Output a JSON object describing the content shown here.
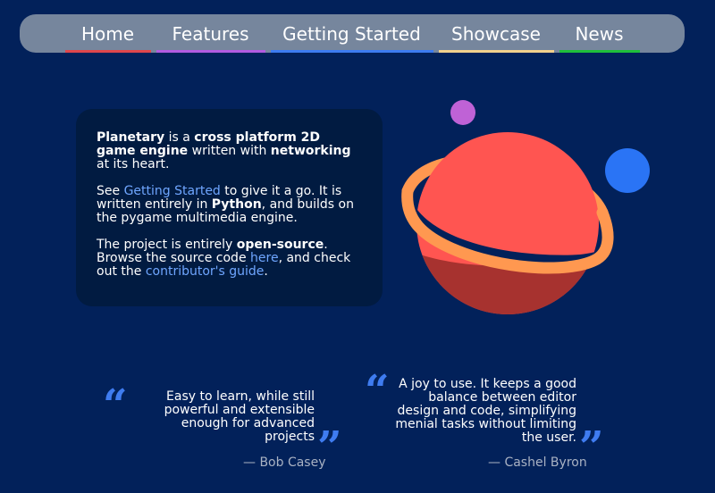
{
  "nav": {
    "items": [
      {
        "label": "Home",
        "color": "#e0474c"
      },
      {
        "label": "Features",
        "color": "#b25ce0"
      },
      {
        "label": "Getting Started",
        "color": "#3d7cf0"
      },
      {
        "label": "Showcase",
        "color": "#f1d08c"
      },
      {
        "label": "News",
        "color": "#1fbf3a"
      }
    ]
  },
  "intro": {
    "p1": {
      "a": "Planetary",
      "b": " is a ",
      "c": "cross platform 2D game engine",
      "d": " written with ",
      "e": "networking",
      "f": " at its heart."
    },
    "p2": {
      "a": "See ",
      "link": "Getting Started",
      "b": " to give it a go. It is written entirely in ",
      "c": "Python",
      "d": ", and builds on the pygame multimedia engine."
    },
    "p3": {
      "a": "The project is entirely ",
      "b": "open-source",
      "c": ". Browse the source code ",
      "link1": "here",
      "d": ", and check out the ",
      "link2": "contributor's guide",
      "e": "."
    }
  },
  "quotes": [
    {
      "open": "“",
      "close": "”",
      "lines": [
        "Easy to learn, while still",
        "powerful and extensible",
        "enough for advanced",
        "projects"
      ],
      "author": "— Bob Casey"
    },
    {
      "open": "“",
      "close": "”",
      "lines": [
        "A joy to use. It keeps a good",
        "balance between editor",
        "design and code, simplifying",
        "menial tasks without limiting",
        "the user."
      ],
      "author": "— Cashel Byron"
    }
  ],
  "colors": {
    "background": "#02215a",
    "card": "#011b41",
    "link": "#6fa6ff",
    "quote_mark": "#3f7cf0",
    "planet": "#ff5551",
    "planet_shadow": "#a7322f",
    "ring": "#ff9850",
    "moon_purple": "#bf62d6",
    "moon_blue": "#2a74f5"
  },
  "icons": {
    "planet": "planet-illustration",
    "quote_open": "open-quote-icon",
    "quote_close": "close-quote-icon"
  }
}
